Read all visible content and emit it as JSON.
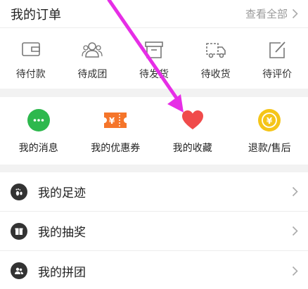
{
  "orders": {
    "title": "我的订单",
    "view_all": "查看全部",
    "statuses": [
      {
        "label": "待付款",
        "icon": "wallet-icon"
      },
      {
        "label": "待成团",
        "icon": "group-icon"
      },
      {
        "label": "待发货",
        "icon": "box-icon"
      },
      {
        "label": "待收货",
        "icon": "truck-icon"
      },
      {
        "label": "待评价",
        "icon": "edit-icon"
      }
    ]
  },
  "services": [
    {
      "label": "我的消息",
      "icon": "message-icon",
      "color": "#2db84d"
    },
    {
      "label": "我的优惠券",
      "icon": "coupon-icon",
      "color": "#f5752a"
    },
    {
      "label": "我的收藏",
      "icon": "heart-icon",
      "color": "#f04b4b"
    },
    {
      "label": "退款/售后",
      "icon": "refund-icon",
      "color": "#f5c518"
    }
  ],
  "menu": [
    {
      "label": "我的足迹",
      "icon": "footprint-icon"
    },
    {
      "label": "我的抽奖",
      "icon": "lottery-icon"
    },
    {
      "label": "我的拼团",
      "icon": "team-icon"
    }
  ],
  "annotation": {
    "arrow_color": "#e62ee6"
  }
}
